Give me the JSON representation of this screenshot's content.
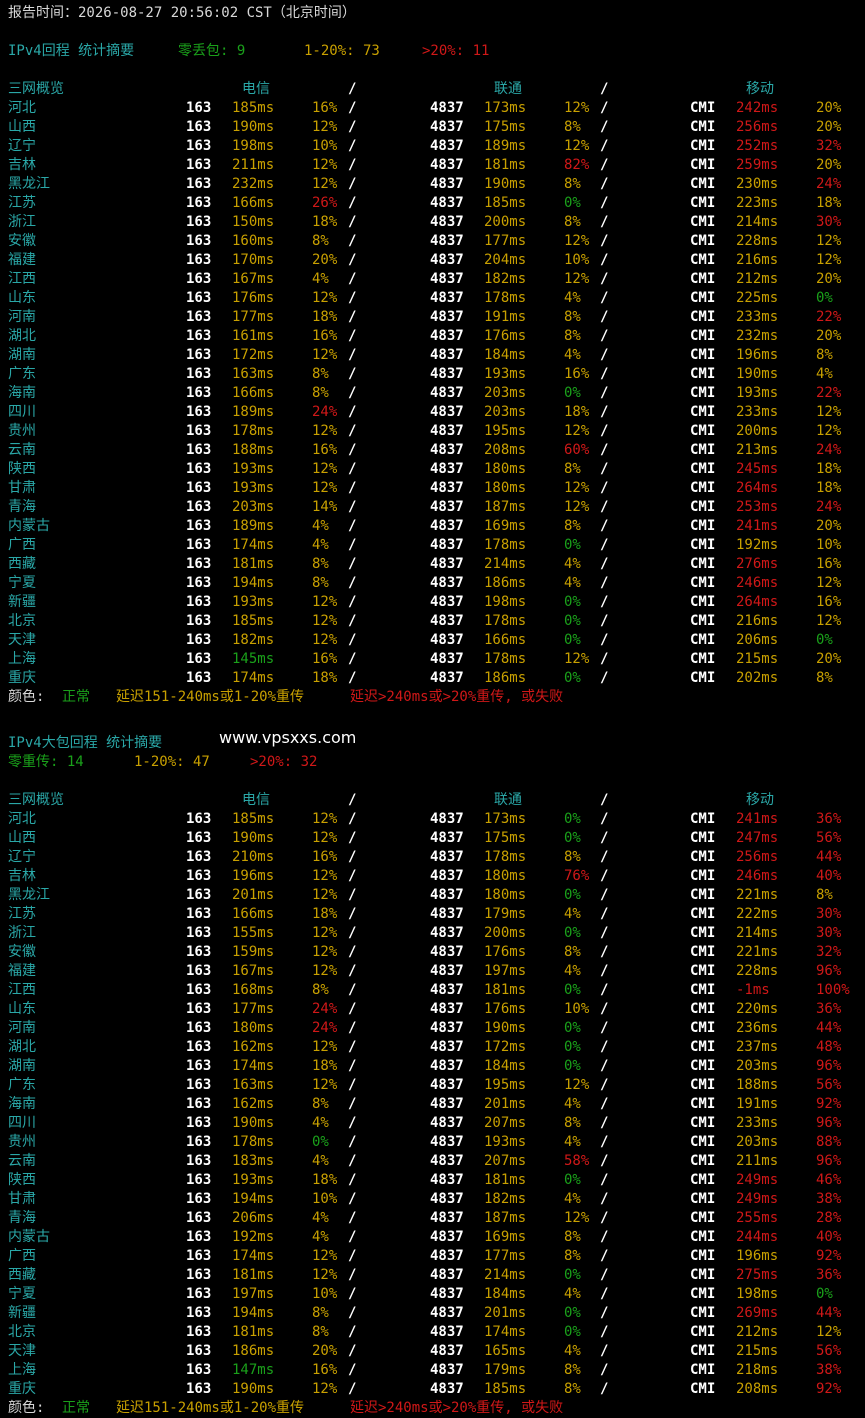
{
  "colors": {
    "white": "#d8d8d8",
    "cyan": "#2aa7a7",
    "yellow": "#c8a000",
    "red": "#d01818",
    "green": "#1aa01a",
    "background": "#000000"
  },
  "report_line": "报告时间：2026-08-27 20:56:02 CST（北京时间）",
  "watermark": "www.vpsxxs.com",
  "sections": [
    {
      "summary": [
        {
          "text": "IPv4回程 统计摘要",
          "color": "cyan"
        },
        {
          "text": "零丢包: 9",
          "color": "green"
        },
        {
          "text": "1-20%: 73",
          "color": "yellow"
        },
        {
          "text": ">20%: 11",
          "color": "red"
        }
      ],
      "header": {
        "region": "三网概览",
        "telecom": "电信",
        "sep1": "/",
        "unicom": "联通",
        "sep2": "/",
        "mobile": "移动"
      },
      "rows": [
        [
          "河北",
          "163",
          "185ms",
          "y",
          "16%",
          "y",
          "4837",
          "173ms",
          "y",
          "12%",
          "y",
          "CMI",
          "242ms",
          "r",
          "20%",
          "y"
        ],
        [
          "山西",
          "163",
          "190ms",
          "y",
          "12%",
          "y",
          "4837",
          "175ms",
          "y",
          "8%",
          "y",
          "CMI",
          "256ms",
          "r",
          "20%",
          "y"
        ],
        [
          "辽宁",
          "163",
          "198ms",
          "y",
          "10%",
          "y",
          "4837",
          "189ms",
          "y",
          "12%",
          "y",
          "CMI",
          "252ms",
          "r",
          "32%",
          "r"
        ],
        [
          "吉林",
          "163",
          "211ms",
          "y",
          "12%",
          "y",
          "4837",
          "181ms",
          "y",
          "82%",
          "r",
          "CMI",
          "259ms",
          "r",
          "20%",
          "y"
        ],
        [
          "黑龙江",
          "163",
          "232ms",
          "y",
          "12%",
          "y",
          "4837",
          "190ms",
          "y",
          "8%",
          "y",
          "CMI",
          "230ms",
          "y",
          "24%",
          "r"
        ],
        [
          "江苏",
          "163",
          "166ms",
          "y",
          "26%",
          "r",
          "4837",
          "185ms",
          "y",
          "0%",
          "g",
          "CMI",
          "223ms",
          "y",
          "18%",
          "y"
        ],
        [
          "浙江",
          "163",
          "150ms",
          "y",
          "18%",
          "y",
          "4837",
          "200ms",
          "y",
          "8%",
          "y",
          "CMI",
          "214ms",
          "y",
          "30%",
          "r"
        ],
        [
          "安徽",
          "163",
          "160ms",
          "y",
          "8%",
          "y",
          "4837",
          "177ms",
          "y",
          "12%",
          "y",
          "CMI",
          "228ms",
          "y",
          "12%",
          "y"
        ],
        [
          "福建",
          "163",
          "170ms",
          "y",
          "20%",
          "y",
          "4837",
          "204ms",
          "y",
          "10%",
          "y",
          "CMI",
          "216ms",
          "y",
          "12%",
          "y"
        ],
        [
          "江西",
          "163",
          "167ms",
          "y",
          "4%",
          "y",
          "4837",
          "182ms",
          "y",
          "12%",
          "y",
          "CMI",
          "212ms",
          "y",
          "20%",
          "y"
        ],
        [
          "山东",
          "163",
          "176ms",
          "y",
          "12%",
          "y",
          "4837",
          "178ms",
          "y",
          "4%",
          "y",
          "CMI",
          "225ms",
          "y",
          "0%",
          "g"
        ],
        [
          "河南",
          "163",
          "177ms",
          "y",
          "18%",
          "y",
          "4837",
          "191ms",
          "y",
          "8%",
          "y",
          "CMI",
          "233ms",
          "y",
          "22%",
          "r"
        ],
        [
          "湖北",
          "163",
          "161ms",
          "y",
          "16%",
          "y",
          "4837",
          "176ms",
          "y",
          "8%",
          "y",
          "CMI",
          "232ms",
          "y",
          "20%",
          "y"
        ],
        [
          "湖南",
          "163",
          "172ms",
          "y",
          "12%",
          "y",
          "4837",
          "184ms",
          "y",
          "4%",
          "y",
          "CMI",
          "196ms",
          "y",
          "8%",
          "y"
        ],
        [
          "广东",
          "163",
          "163ms",
          "y",
          "8%",
          "y",
          "4837",
          "193ms",
          "y",
          "16%",
          "y",
          "CMI",
          "190ms",
          "y",
          "4%",
          "y"
        ],
        [
          "海南",
          "163",
          "166ms",
          "y",
          "8%",
          "y",
          "4837",
          "203ms",
          "y",
          "0%",
          "g",
          "CMI",
          "193ms",
          "y",
          "22%",
          "r"
        ],
        [
          "四川",
          "163",
          "189ms",
          "y",
          "24%",
          "r",
          "4837",
          "203ms",
          "y",
          "18%",
          "y",
          "CMI",
          "233ms",
          "y",
          "12%",
          "y"
        ],
        [
          "贵州",
          "163",
          "178ms",
          "y",
          "12%",
          "y",
          "4837",
          "195ms",
          "y",
          "12%",
          "y",
          "CMI",
          "200ms",
          "y",
          "12%",
          "y"
        ],
        [
          "云南",
          "163",
          "188ms",
          "y",
          "16%",
          "y",
          "4837",
          "208ms",
          "y",
          "60%",
          "r",
          "CMI",
          "213ms",
          "y",
          "24%",
          "r"
        ],
        [
          "陕西",
          "163",
          "193ms",
          "y",
          "12%",
          "y",
          "4837",
          "180ms",
          "y",
          "8%",
          "y",
          "CMI",
          "245ms",
          "r",
          "18%",
          "y"
        ],
        [
          "甘肃",
          "163",
          "193ms",
          "y",
          "12%",
          "y",
          "4837",
          "180ms",
          "y",
          "12%",
          "y",
          "CMI",
          "264ms",
          "r",
          "18%",
          "y"
        ],
        [
          "青海",
          "163",
          "203ms",
          "y",
          "14%",
          "y",
          "4837",
          "187ms",
          "y",
          "12%",
          "y",
          "CMI",
          "253ms",
          "r",
          "24%",
          "r"
        ],
        [
          "内蒙古",
          "163",
          "189ms",
          "y",
          "4%",
          "y",
          "4837",
          "169ms",
          "y",
          "8%",
          "y",
          "CMI",
          "241ms",
          "r",
          "20%",
          "y"
        ],
        [
          "广西",
          "163",
          "174ms",
          "y",
          "4%",
          "y",
          "4837",
          "178ms",
          "y",
          "0%",
          "g",
          "CMI",
          "192ms",
          "y",
          "10%",
          "y"
        ],
        [
          "西藏",
          "163",
          "181ms",
          "y",
          "8%",
          "y",
          "4837",
          "214ms",
          "y",
          "4%",
          "y",
          "CMI",
          "276ms",
          "r",
          "16%",
          "y"
        ],
        [
          "宁夏",
          "163",
          "194ms",
          "y",
          "8%",
          "y",
          "4837",
          "186ms",
          "y",
          "4%",
          "y",
          "CMI",
          "246ms",
          "r",
          "12%",
          "y"
        ],
        [
          "新疆",
          "163",
          "193ms",
          "y",
          "12%",
          "y",
          "4837",
          "198ms",
          "y",
          "0%",
          "g",
          "CMI",
          "264ms",
          "r",
          "16%",
          "y"
        ],
        [
          "北京",
          "163",
          "185ms",
          "y",
          "12%",
          "y",
          "4837",
          "178ms",
          "y",
          "0%",
          "g",
          "CMI",
          "216ms",
          "y",
          "12%",
          "y"
        ],
        [
          "天津",
          "163",
          "182ms",
          "y",
          "12%",
          "y",
          "4837",
          "166ms",
          "y",
          "0%",
          "g",
          "CMI",
          "206ms",
          "y",
          "0%",
          "g"
        ],
        [
          "上海",
          "163",
          "145ms",
          "g",
          "16%",
          "y",
          "4837",
          "178ms",
          "y",
          "12%",
          "y",
          "CMI",
          "215ms",
          "y",
          "20%",
          "y"
        ],
        [
          "重庆",
          "163",
          "174ms",
          "y",
          "18%",
          "y",
          "4837",
          "186ms",
          "y",
          "0%",
          "g",
          "CMI",
          "202ms",
          "y",
          "8%",
          "y"
        ]
      ],
      "legend": [
        {
          "text": "颜色:",
          "color": "white"
        },
        {
          "text": "正常",
          "color": "green"
        },
        {
          "text": "延迟151-240ms或1-20%重传",
          "color": "yellow"
        },
        {
          "text": "延迟>240ms或>20%重传, 或失败",
          "color": "red"
        }
      ]
    },
    {
      "summary": [
        {
          "text": "IPv4大包回程 统计摘要",
          "color": "cyan"
        },
        {
          "text": "零重传: 14",
          "color": "green"
        },
        {
          "text": "1-20%: 47",
          "color": "yellow"
        },
        {
          "text": ">20%: 32",
          "color": "red"
        }
      ],
      "header": {
        "region": "三网概览",
        "telecom": "电信",
        "sep1": "/",
        "unicom": "联通",
        "sep2": "/",
        "mobile": "移动"
      },
      "rows": [
        [
          "河北",
          "163",
          "185ms",
          "y",
          "12%",
          "y",
          "4837",
          "173ms",
          "y",
          "0%",
          "g",
          "CMI",
          "241ms",
          "r",
          "36%",
          "r"
        ],
        [
          "山西",
          "163",
          "190ms",
          "y",
          "12%",
          "y",
          "4837",
          "175ms",
          "y",
          "0%",
          "g",
          "CMI",
          "247ms",
          "r",
          "56%",
          "r"
        ],
        [
          "辽宁",
          "163",
          "210ms",
          "y",
          "16%",
          "y",
          "4837",
          "178ms",
          "y",
          "8%",
          "y",
          "CMI",
          "256ms",
          "r",
          "44%",
          "r"
        ],
        [
          "吉林",
          "163",
          "196ms",
          "y",
          "12%",
          "y",
          "4837",
          "180ms",
          "y",
          "76%",
          "r",
          "CMI",
          "246ms",
          "r",
          "40%",
          "r"
        ],
        [
          "黑龙江",
          "163",
          "201ms",
          "y",
          "12%",
          "y",
          "4837",
          "180ms",
          "y",
          "0%",
          "g",
          "CMI",
          "221ms",
          "y",
          "8%",
          "y"
        ],
        [
          "江苏",
          "163",
          "166ms",
          "y",
          "18%",
          "y",
          "4837",
          "179ms",
          "y",
          "4%",
          "y",
          "CMI",
          "222ms",
          "y",
          "30%",
          "r"
        ],
        [
          "浙江",
          "163",
          "155ms",
          "y",
          "12%",
          "y",
          "4837",
          "200ms",
          "y",
          "0%",
          "g",
          "CMI",
          "214ms",
          "y",
          "30%",
          "r"
        ],
        [
          "安徽",
          "163",
          "159ms",
          "y",
          "12%",
          "y",
          "4837",
          "176ms",
          "y",
          "8%",
          "y",
          "CMI",
          "221ms",
          "y",
          "32%",
          "r"
        ],
        [
          "福建",
          "163",
          "167ms",
          "y",
          "12%",
          "y",
          "4837",
          "197ms",
          "y",
          "4%",
          "y",
          "CMI",
          "228ms",
          "y",
          "96%",
          "r"
        ],
        [
          "江西",
          "163",
          "168ms",
          "y",
          "8%",
          "y",
          "4837",
          "181ms",
          "y",
          "0%",
          "g",
          "CMI",
          "-1ms",
          "r",
          "100%",
          "r"
        ],
        [
          "山东",
          "163",
          "177ms",
          "y",
          "24%",
          "r",
          "4837",
          "176ms",
          "y",
          "10%",
          "y",
          "CMI",
          "220ms",
          "y",
          "36%",
          "r"
        ],
        [
          "河南",
          "163",
          "180ms",
          "y",
          "24%",
          "r",
          "4837",
          "190ms",
          "y",
          "0%",
          "g",
          "CMI",
          "236ms",
          "y",
          "44%",
          "r"
        ],
        [
          "湖北",
          "163",
          "162ms",
          "y",
          "12%",
          "y",
          "4837",
          "172ms",
          "y",
          "0%",
          "g",
          "CMI",
          "237ms",
          "y",
          "48%",
          "r"
        ],
        [
          "湖南",
          "163",
          "174ms",
          "y",
          "18%",
          "y",
          "4837",
          "184ms",
          "y",
          "0%",
          "g",
          "CMI",
          "203ms",
          "y",
          "96%",
          "r"
        ],
        [
          "广东",
          "163",
          "163ms",
          "y",
          "12%",
          "y",
          "4837",
          "195ms",
          "y",
          "12%",
          "y",
          "CMI",
          "188ms",
          "y",
          "56%",
          "r"
        ],
        [
          "海南",
          "163",
          "162ms",
          "y",
          "8%",
          "y",
          "4837",
          "201ms",
          "y",
          "4%",
          "y",
          "CMI",
          "191ms",
          "y",
          "92%",
          "r"
        ],
        [
          "四川",
          "163",
          "190ms",
          "y",
          "4%",
          "y",
          "4837",
          "207ms",
          "y",
          "8%",
          "y",
          "CMI",
          "233ms",
          "y",
          "96%",
          "r"
        ],
        [
          "贵州",
          "163",
          "178ms",
          "y",
          "0%",
          "g",
          "4837",
          "193ms",
          "y",
          "4%",
          "y",
          "CMI",
          "203ms",
          "y",
          "88%",
          "r"
        ],
        [
          "云南",
          "163",
          "183ms",
          "y",
          "4%",
          "y",
          "4837",
          "207ms",
          "y",
          "58%",
          "r",
          "CMI",
          "211ms",
          "y",
          "96%",
          "r"
        ],
        [
          "陕西",
          "163",
          "193ms",
          "y",
          "18%",
          "y",
          "4837",
          "181ms",
          "y",
          "0%",
          "g",
          "CMI",
          "249ms",
          "r",
          "46%",
          "r"
        ],
        [
          "甘肃",
          "163",
          "194ms",
          "y",
          "10%",
          "y",
          "4837",
          "182ms",
          "y",
          "4%",
          "y",
          "CMI",
          "249ms",
          "r",
          "38%",
          "r"
        ],
        [
          "青海",
          "163",
          "206ms",
          "y",
          "4%",
          "y",
          "4837",
          "187ms",
          "y",
          "12%",
          "y",
          "CMI",
          "255ms",
          "r",
          "28%",
          "r"
        ],
        [
          "内蒙古",
          "163",
          "192ms",
          "y",
          "4%",
          "y",
          "4837",
          "169ms",
          "y",
          "8%",
          "y",
          "CMI",
          "244ms",
          "r",
          "40%",
          "r"
        ],
        [
          "广西",
          "163",
          "174ms",
          "y",
          "12%",
          "y",
          "4837",
          "177ms",
          "y",
          "8%",
          "y",
          "CMI",
          "196ms",
          "y",
          "92%",
          "r"
        ],
        [
          "西藏",
          "163",
          "181ms",
          "y",
          "12%",
          "y",
          "4837",
          "214ms",
          "y",
          "0%",
          "g",
          "CMI",
          "275ms",
          "r",
          "36%",
          "r"
        ],
        [
          "宁夏",
          "163",
          "197ms",
          "y",
          "10%",
          "y",
          "4837",
          "184ms",
          "y",
          "4%",
          "y",
          "CMI",
          "198ms",
          "y",
          "0%",
          "g"
        ],
        [
          "新疆",
          "163",
          "194ms",
          "y",
          "8%",
          "y",
          "4837",
          "201ms",
          "y",
          "0%",
          "g",
          "CMI",
          "269ms",
          "r",
          "44%",
          "r"
        ],
        [
          "北京",
          "163",
          "181ms",
          "y",
          "8%",
          "y",
          "4837",
          "174ms",
          "y",
          "0%",
          "g",
          "CMI",
          "212ms",
          "y",
          "12%",
          "y"
        ],
        [
          "天津",
          "163",
          "186ms",
          "y",
          "20%",
          "y",
          "4837",
          "165ms",
          "y",
          "4%",
          "y",
          "CMI",
          "215ms",
          "y",
          "56%",
          "r"
        ],
        [
          "上海",
          "163",
          "147ms",
          "g",
          "16%",
          "y",
          "4837",
          "179ms",
          "y",
          "8%",
          "y",
          "CMI",
          "218ms",
          "y",
          "38%",
          "r"
        ],
        [
          "重庆",
          "163",
          "190ms",
          "y",
          "12%",
          "y",
          "4837",
          "185ms",
          "y",
          "8%",
          "y",
          "CMI",
          "208ms",
          "y",
          "92%",
          "r"
        ]
      ],
      "legend": [
        {
          "text": "颜色:",
          "color": "white"
        },
        {
          "text": "正常",
          "color": "green"
        },
        {
          "text": "延迟151-240ms或1-20%重传",
          "color": "yellow"
        },
        {
          "text": "延迟>240ms或>20%重传, 或失败",
          "color": "red"
        }
      ]
    }
  ]
}
